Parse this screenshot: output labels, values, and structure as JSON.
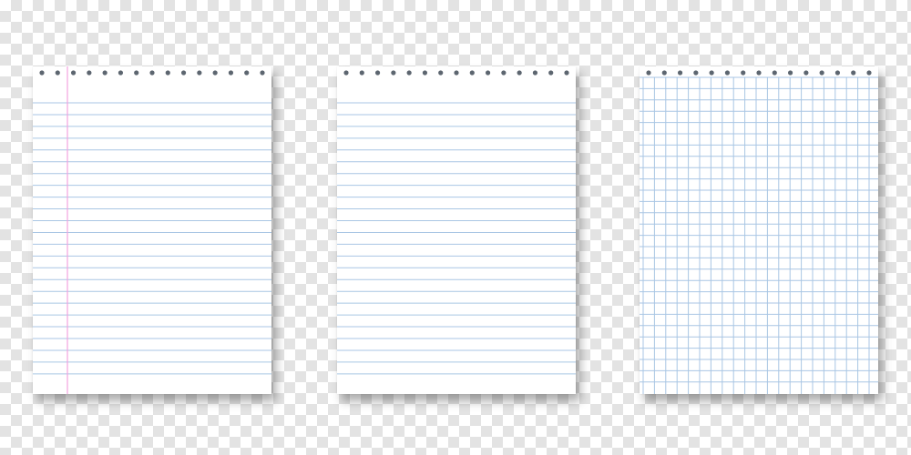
{
  "image_id_text": "296286129",
  "colors": {
    "checker_light": "#ffffff",
    "checker_dark": "#e3e3e3",
    "paper": "#ffffff",
    "rule_line": "#a9c6e4",
    "margin_line": "#f2a3df",
    "punch_hole": "#5d6670"
  },
  "sheets": [
    {
      "style": "lined-with-margin",
      "ruled_lines": 24,
      "punch_holes": 15
    },
    {
      "style": "lined",
      "ruled_lines": 24,
      "punch_holes": 15
    },
    {
      "style": "grid",
      "punch_holes": 15
    }
  ]
}
